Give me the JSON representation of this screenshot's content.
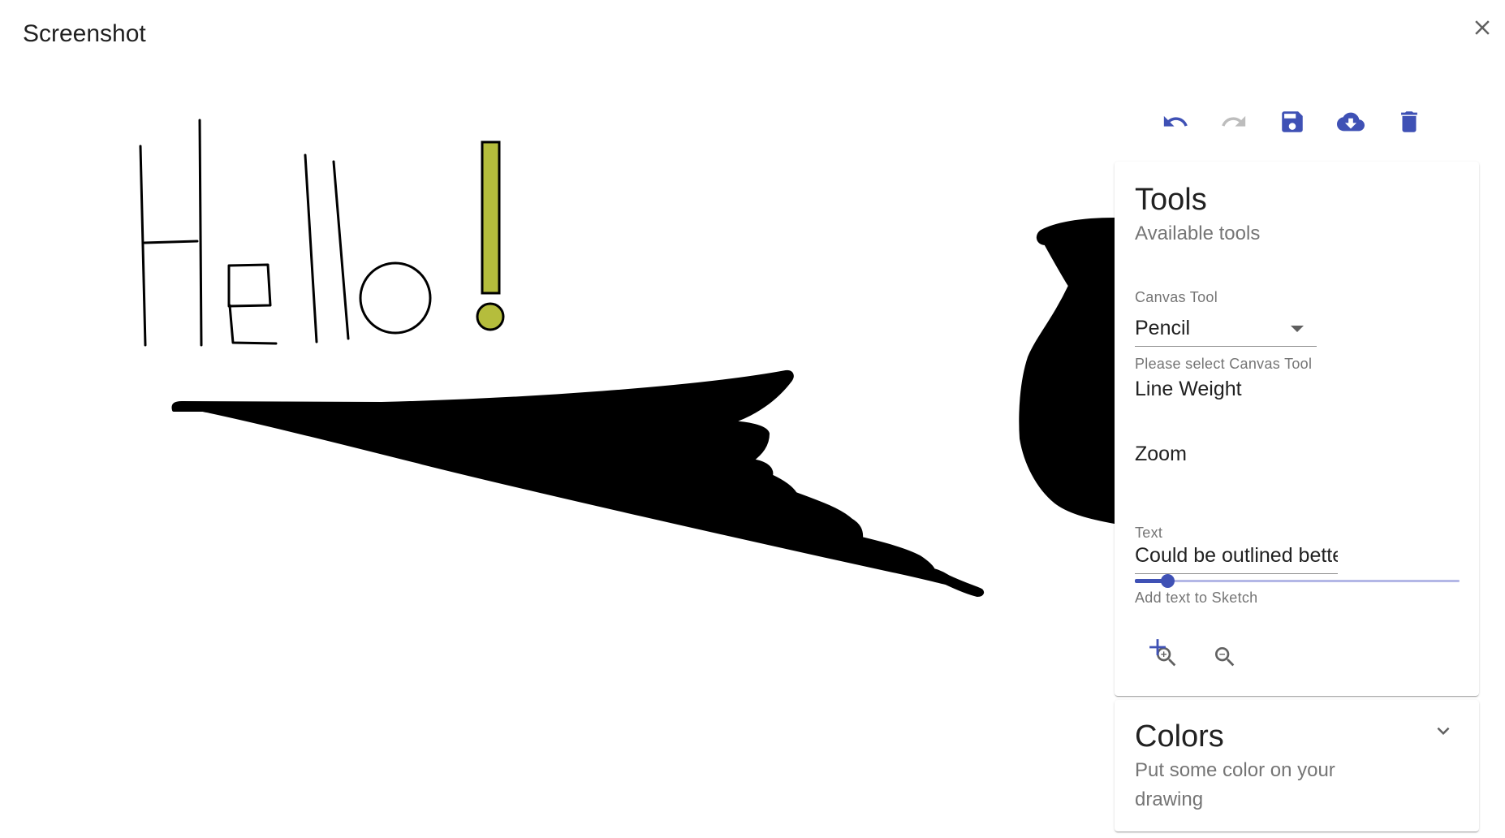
{
  "dialog": {
    "title": "Screenshot"
  },
  "toolbar": {
    "undo_icon": "undo-icon",
    "redo_icon": "redo-icon",
    "save_icon": "save-icon",
    "download_icon": "cloud-download-icon",
    "delete_icon": "delete-icon",
    "redo_enabled": false,
    "accent_color": "#3f51b5",
    "disabled_color": "#bdbdbd"
  },
  "tools": {
    "title": "Tools",
    "subtitle": "Available tools",
    "canvas_tool_label": "Canvas Tool",
    "canvas_tool_value": "Pencil",
    "canvas_tool_helper": "Please select Canvas Tool",
    "line_weight_label": "Line Weight",
    "line_weight_fraction": 0.1,
    "zoom_label": "Zoom",
    "text_label": "Text",
    "text_value": "Could be outlined bette",
    "text_helper": "Add text to Sketch"
  },
  "colors": {
    "title": "Colors",
    "subtitle_line1": "Put some color on your",
    "subtitle_line2": "drawing"
  },
  "sketch": {
    "stroke_color": "#000000",
    "exclamation_fill": "#b5bd3c"
  }
}
